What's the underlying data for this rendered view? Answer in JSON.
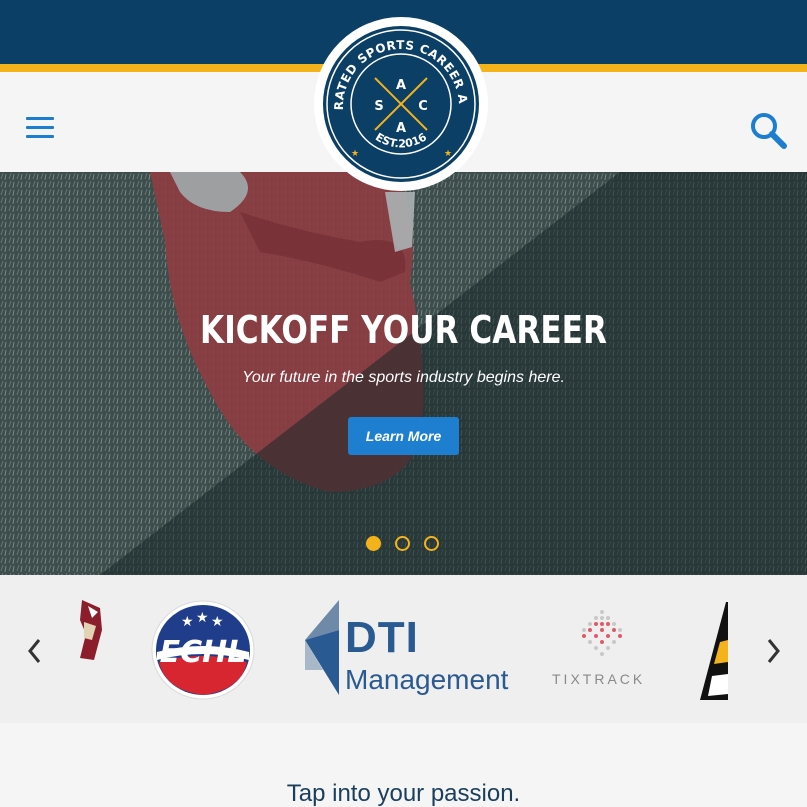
{
  "header": {
    "logo": {
      "ring_text": "ACCELERATED SPORTS CAREER ACADEMY",
      "letters": [
        "S",
        "A",
        "C",
        "A"
      ],
      "est": "EST.2016"
    },
    "menu_icon": "hamburger-menu-icon",
    "search_icon": "search-icon"
  },
  "hero": {
    "title": "KICKOFF YOUR CAREER",
    "subtitle": "Your future in the sports industry begins here.",
    "button_label": "Learn More",
    "slides_total": 3,
    "active_slide": 1
  },
  "partners": {
    "items": [
      {
        "name": "coyotes-logo-partial"
      },
      {
        "name": "echl-logo",
        "label": "ECHL"
      },
      {
        "name": "dti-management-logo",
        "label": "DTI",
        "sublabel": "Management"
      },
      {
        "name": "tixtrack-logo",
        "label": "TIXTRACK"
      },
      {
        "name": "partner-logo-partial"
      }
    ]
  },
  "intro": {
    "tagline": "Tap into your passion."
  },
  "colors": {
    "navy": "#0b3f66",
    "gold": "#f4b21b",
    "accent_blue": "#1e7fd0"
  }
}
